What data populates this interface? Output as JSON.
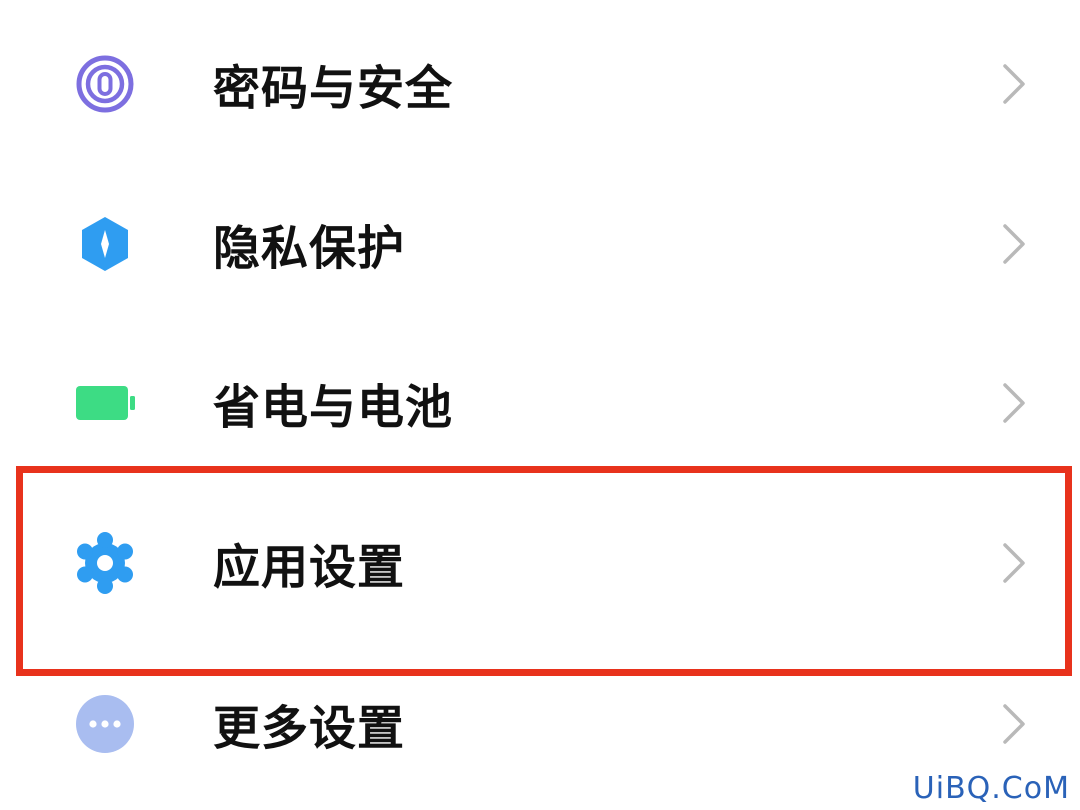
{
  "settings_list": {
    "items": [
      {
        "label": "密码与安全",
        "icon": "fingerprint-icon",
        "icon_color": "#7d6fe0"
      },
      {
        "label": "隐私保护",
        "icon": "privacy-shield-icon",
        "icon_color": "#2f9df1"
      },
      {
        "label": "省电与电池",
        "icon": "battery-icon",
        "icon_color": "#3ddc84"
      },
      {
        "label": "应用设置",
        "icon": "gear-icon",
        "icon_color": "#2f9df1"
      },
      {
        "label": "更多设置",
        "icon": "more-dots-icon",
        "icon_color": "#9fb5ee"
      }
    ],
    "chevron_icon": "chevron-right-icon"
  },
  "highlight": {
    "color": "#e8321c",
    "target": "应用设置"
  },
  "watermark": {
    "text": "UiBQ.CoM",
    "color": "#2a62b8"
  }
}
